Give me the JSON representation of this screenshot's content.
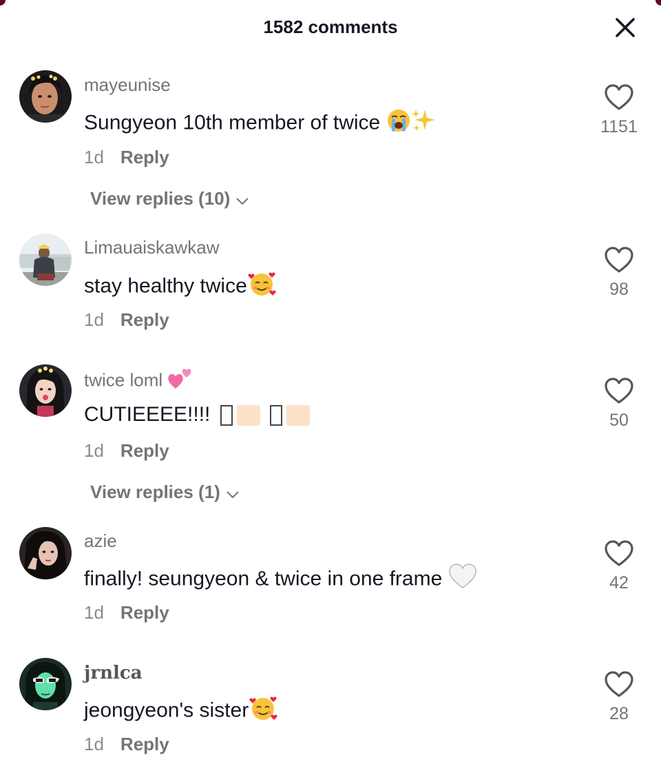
{
  "header": {
    "title": "1582 comments",
    "close_icon": "close-icon"
  },
  "comments": [
    {
      "username": "mayeunise",
      "text": "Sungyeon 10th member of twice",
      "emojis": [
        "loudly-crying-face",
        "sparkles"
      ],
      "time": "1d",
      "reply_label": "Reply",
      "likes": "1151",
      "view_replies": "View replies (10)"
    },
    {
      "username": "Limauaiskawkaw",
      "text": "stay healthy twice",
      "emojis": [
        "smiling-face-with-hearts"
      ],
      "time": "1d",
      "reply_label": "Reply",
      "likes": "98"
    },
    {
      "username": "twice loml",
      "username_emoji": "two-hearts",
      "text": "CUTIEEEE!!!!",
      "emojis": [
        "missing-glyph",
        "skin-tone",
        "missing-glyph",
        "skin-tone"
      ],
      "time": "1d",
      "reply_label": "Reply",
      "likes": "50",
      "view_replies": "View replies (1)"
    },
    {
      "username": "azie",
      "text": "finally! seungyeon & twice in one frame",
      "emojis": [
        "white-heart"
      ],
      "time": "1d",
      "reply_label": "Reply",
      "likes": "42"
    },
    {
      "username": "jrnlca",
      "text": "jeongyeon's sister",
      "emojis": [
        "smiling-face-with-hearts"
      ],
      "time": "1d",
      "reply_label": "Reply",
      "likes": "28"
    }
  ],
  "colors": {
    "text_primary": "#161823",
    "text_secondary": "#737478",
    "background": "#ffffff"
  }
}
